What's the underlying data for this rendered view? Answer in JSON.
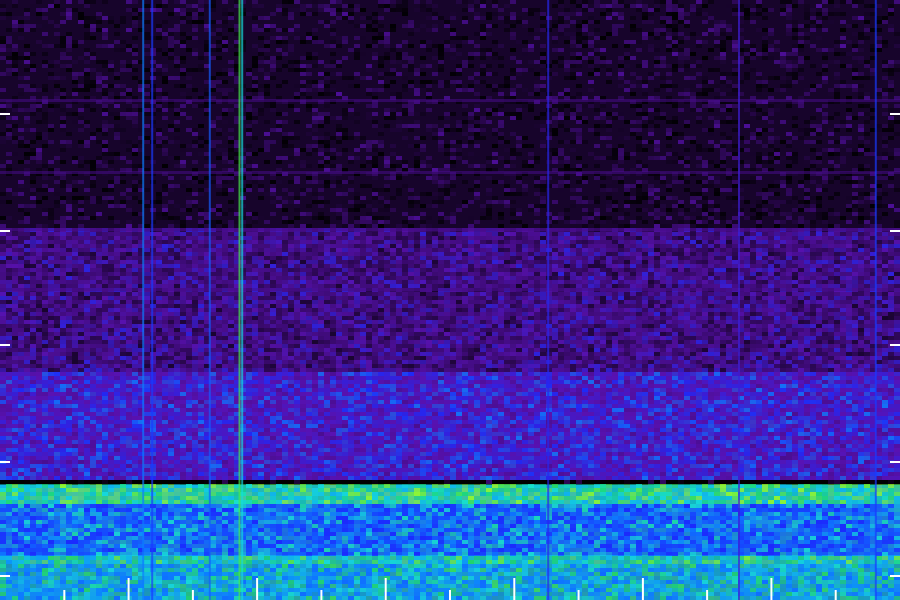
{
  "chart_data": {
    "type": "heatmap",
    "title": "",
    "xlabel": "",
    "ylabel": "",
    "colormap": [
      "#000000",
      "#3a0a6e",
      "#5a12b4",
      "#1a2cff",
      "#0a8cff",
      "#18e6d2",
      "#22e05a",
      "#9cff1e"
    ],
    "x_tick_count": 13,
    "y_tick_fractions": [
      0.19,
      0.385,
      0.575,
      0.77,
      0.96
    ],
    "y_ticks_both_sides": true,
    "grid": false,
    "legend": "none",
    "bands": [
      {
        "name": "noise-floor-low",
        "from": 0.0,
        "to": 0.38,
        "level": 0.08
      },
      {
        "name": "noise-floor-mid",
        "from": 0.38,
        "to": 0.62,
        "level": 0.22
      },
      {
        "name": "rising-noise",
        "from": 0.62,
        "to": 0.8,
        "level": 0.38
      },
      {
        "name": "strong-line-1",
        "from": 0.808,
        "to": 0.84,
        "level": 0.85
      },
      {
        "name": "lower-band",
        "from": 0.84,
        "to": 0.93,
        "level": 0.6
      },
      {
        "name": "strong-line-2",
        "from": 0.925,
        "to": 0.94,
        "level": 0.8
      },
      {
        "name": "floor-band",
        "from": 0.94,
        "to": 1.0,
        "level": 0.72
      }
    ],
    "transients": [
      {
        "x": 0.158,
        "level": 0.55
      },
      {
        "x": 0.168,
        "level": 0.45
      },
      {
        "x": 0.232,
        "level": 0.5
      },
      {
        "x": 0.265,
        "level": 0.9
      },
      {
        "x": 0.268,
        "level": 0.7
      },
      {
        "x": 0.608,
        "level": 0.4
      },
      {
        "x": 0.82,
        "level": 0.35
      },
      {
        "x": 0.972,
        "level": 0.45
      }
    ]
  }
}
